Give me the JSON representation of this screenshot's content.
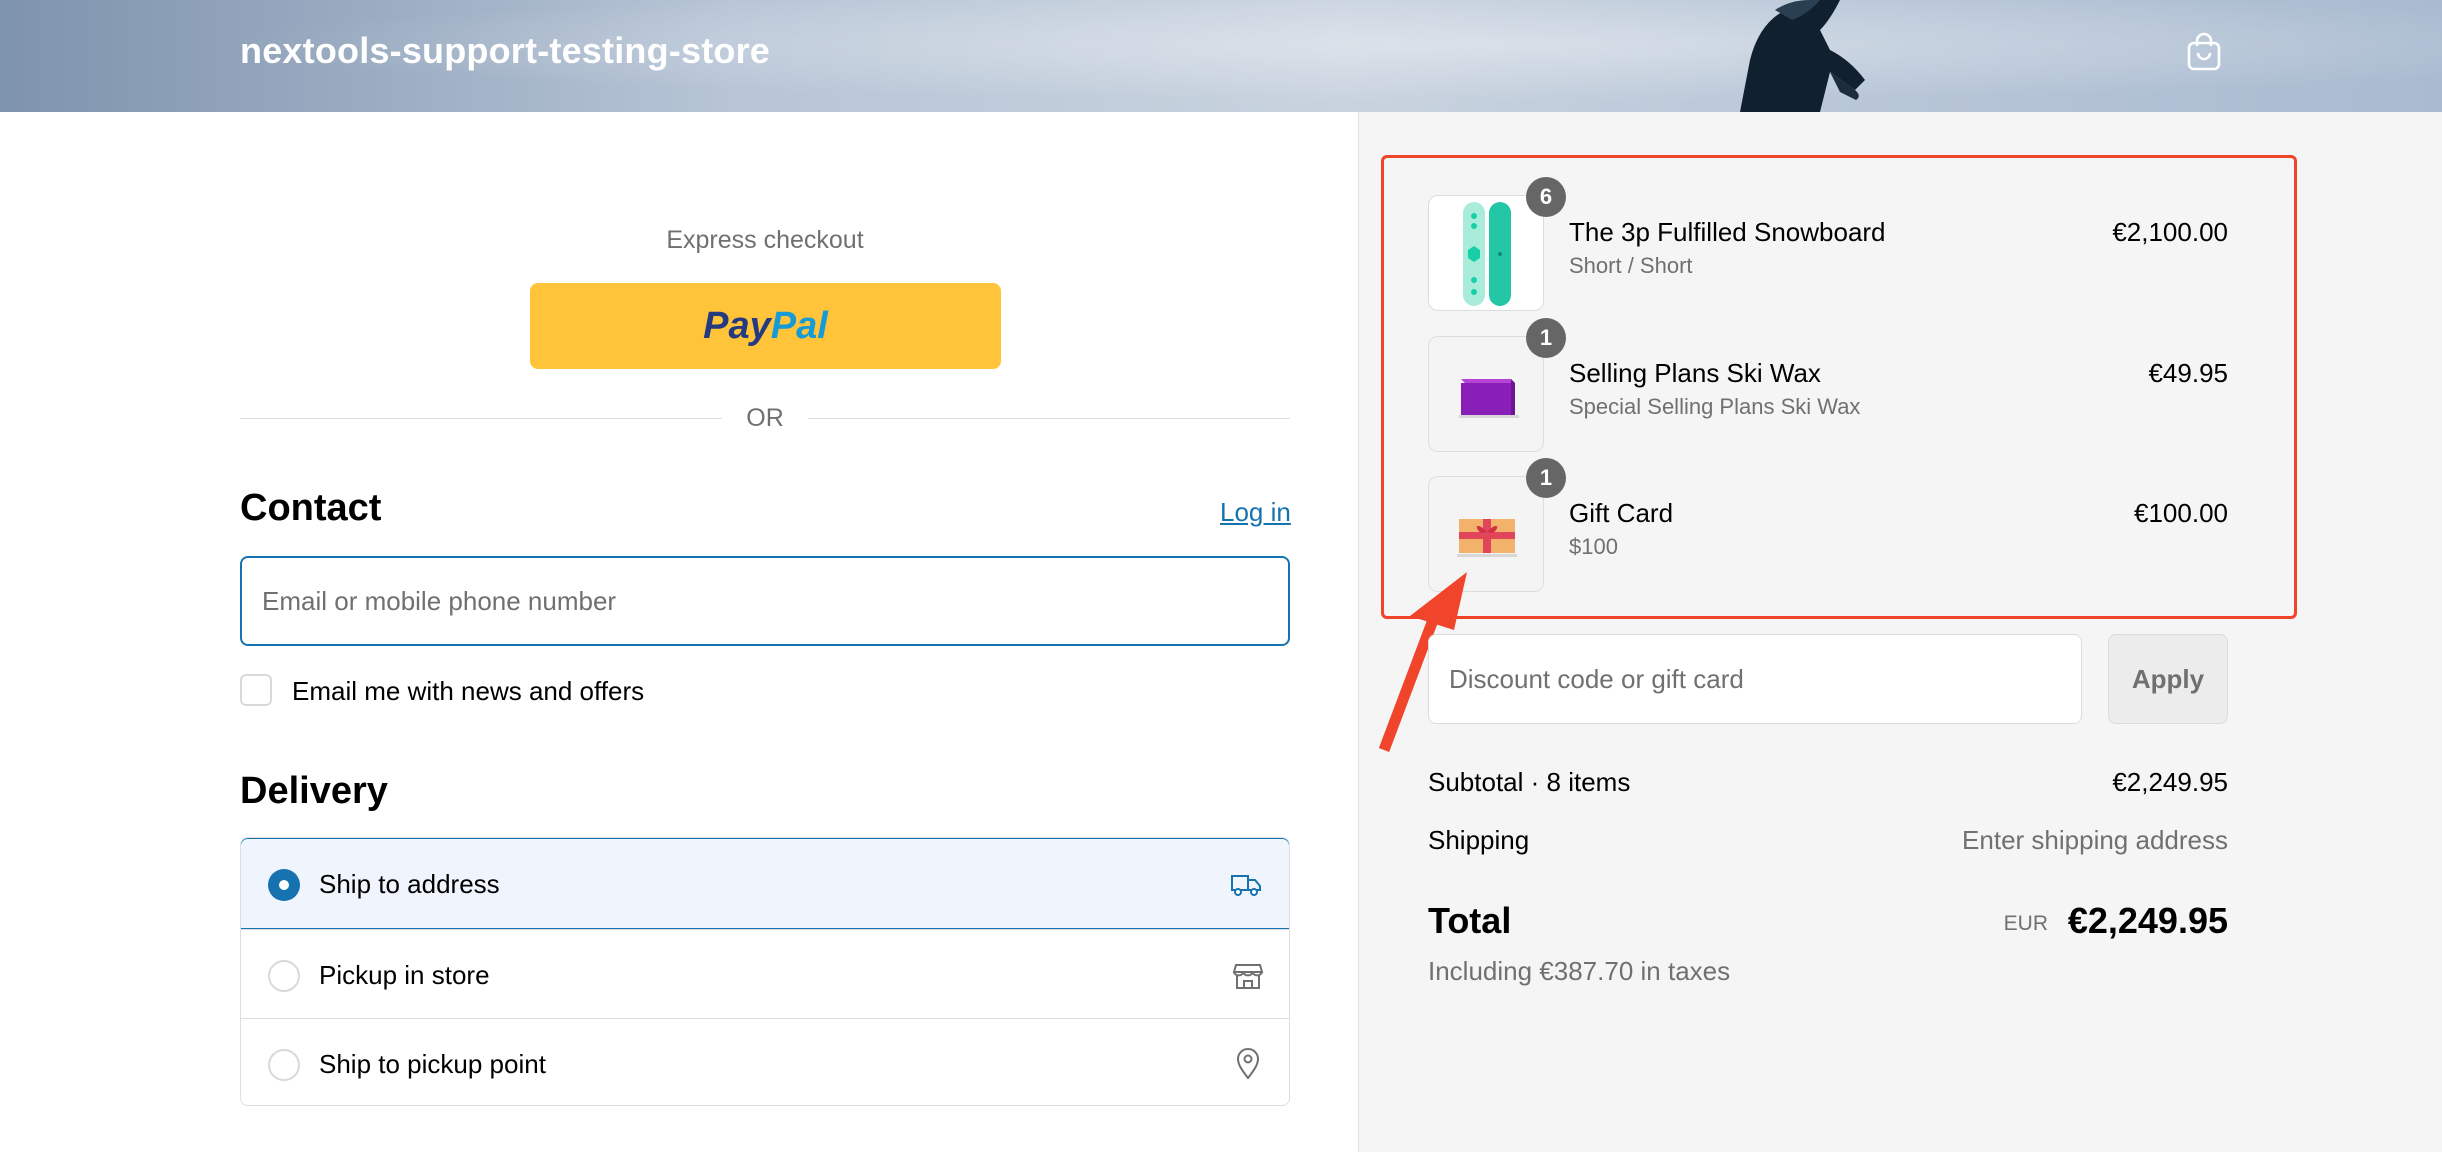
{
  "header": {
    "store_name": "nextools-support-testing-store",
    "cart_icon": "shopping-bag-icon"
  },
  "express": {
    "label": "Express checkout",
    "paypal_part1": "Pay",
    "paypal_part2": "Pal",
    "divider": "OR"
  },
  "contact": {
    "title": "Contact",
    "login_label": "Log in",
    "email_placeholder": "Email or mobile phone number",
    "newsletter_label": "Email me with news and offers"
  },
  "delivery": {
    "title": "Delivery",
    "options": [
      {
        "label": "Ship to address",
        "icon": "truck-icon",
        "selected": true
      },
      {
        "label": "Pickup in store",
        "icon": "store-icon",
        "selected": false
      },
      {
        "label": "Ship to pickup point",
        "icon": "map-pin-icon",
        "selected": false
      }
    ]
  },
  "cart": {
    "items": [
      {
        "quantity": "6",
        "name": "The 3p Fulfilled Snowboard",
        "variant": "Short / Short",
        "price": "€2,100.00"
      },
      {
        "quantity": "1",
        "name": "Selling Plans Ski Wax",
        "variant": "Special Selling Plans Ski Wax",
        "price": "€49.95"
      },
      {
        "quantity": "1",
        "name": "Gift Card",
        "variant": "$100",
        "price": "€100.00"
      }
    ]
  },
  "discount": {
    "placeholder": "Discount code or gift card",
    "apply_label": "Apply"
  },
  "summary": {
    "subtotal_label": "Subtotal · 8 items",
    "subtotal_value": "€2,249.95",
    "shipping_label": "Shipping",
    "shipping_value": "Enter shipping address",
    "total_label": "Total",
    "currency": "EUR",
    "total_value": "€2,249.95",
    "taxes": "Including €387.70 in taxes"
  },
  "colors": {
    "accent": "#1773b0",
    "paypal_yellow": "#ffc439",
    "annotation_red": "#f0442b"
  }
}
